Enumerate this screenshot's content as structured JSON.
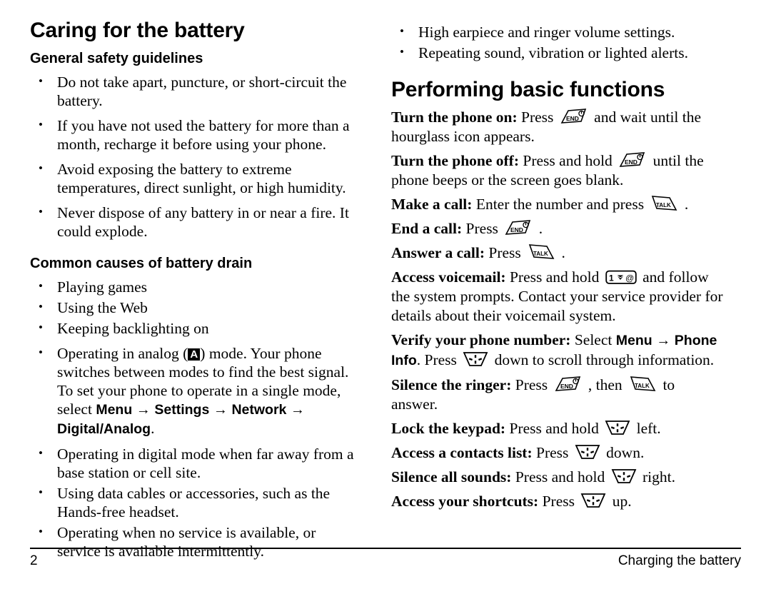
{
  "page": {
    "number": "2",
    "footer_right": "Charging the battery"
  },
  "left_column": {
    "chapter_title": "Caring for the battery",
    "section_1": {
      "heading": "General safety guidelines",
      "bullets": [
        "Do not take apart, puncture, or short-circuit the battery.",
        "If you have not used the battery for more than a month, recharge it before using your phone.",
        "Avoid exposing the battery to extreme temperatures, direct sunlight, or high humidity.",
        "Never dispose of any battery in or near a fire. It could explode."
      ]
    },
    "section_2": {
      "heading": "Common causes of battery drain",
      "bullets": [
        "Playing games",
        "Using the Web",
        "Keeping backlighting on"
      ],
      "analog_bullet": {
        "text_before": "Operating in analog (",
        "badge": "A",
        "text_after": ") mode. Your phone switches between modes to find the best signal. To set your phone to operate in a single mode, select ",
        "menu_path": [
          "Menu",
          "Settings",
          "Network",
          "Digital/Analog"
        ],
        "arrow": "→",
        "period": "."
      },
      "bullets_after": [
        "Operating in digital mode when far away from a base station or cell site.",
        "Using data cables or accessories, such as the Hands-free headset.",
        "Operating when no service is available, or service is available intermittently."
      ]
    }
  },
  "right_column": {
    "top_bullets": [
      "High earpiece and ringer volume settings.",
      "Repeating sound, vibration or lighted alerts."
    ],
    "chapter_title": "Performing basic functions",
    "functions": [
      {
        "label": "Turn the phone on:",
        "parts": [
          {
            "type": "text",
            "value": " Press "
          },
          {
            "type": "icon",
            "value": "end-key-icon"
          },
          {
            "type": "text",
            "value": " and wait until the hourglass icon appears."
          }
        ]
      },
      {
        "label": "Turn the phone off:",
        "parts": [
          {
            "type": "text",
            "value": " Press and hold "
          },
          {
            "type": "icon",
            "value": "end-key-icon"
          },
          {
            "type": "text",
            "value": " until the phone beeps or the screen goes blank."
          }
        ]
      },
      {
        "label": "Make a call:",
        "parts": [
          {
            "type": "text",
            "value": " Enter the number and press "
          },
          {
            "type": "icon",
            "value": "talk-key-icon"
          },
          {
            "type": "text",
            "value": " ."
          }
        ]
      },
      {
        "label": "End a call:",
        "parts": [
          {
            "type": "text",
            "value": " Press "
          },
          {
            "type": "icon",
            "value": "end-key-icon"
          },
          {
            "type": "text",
            "value": " ."
          }
        ]
      },
      {
        "label": "Answer a call:",
        "parts": [
          {
            "type": "text",
            "value": " Press "
          },
          {
            "type": "icon",
            "value": "talk-key-icon"
          },
          {
            "type": "text",
            "value": " ."
          }
        ]
      },
      {
        "label": "Access voicemail:",
        "parts": [
          {
            "type": "text",
            "value": " Press and hold "
          },
          {
            "type": "icon",
            "value": "voicemail-key-icon"
          },
          {
            "type": "text",
            "value": " and follow the system prompts. Contact your service provider for details about their voicemail system."
          }
        ]
      },
      {
        "label": "Verify your phone number:",
        "parts": [
          {
            "type": "text",
            "value": " Select "
          },
          {
            "type": "ui",
            "value": "Menu"
          },
          {
            "type": "arrow",
            "value": " → "
          },
          {
            "type": "ui",
            "value": "Phone Info"
          },
          {
            "type": "text",
            "value": ". Press "
          },
          {
            "type": "icon",
            "value": "nav-key-icon"
          },
          {
            "type": "text",
            "value": " down to scroll through information."
          }
        ]
      },
      {
        "label": "Silence the ringer:",
        "parts": [
          {
            "type": "text",
            "value": " Press "
          },
          {
            "type": "icon",
            "value": "end-key-icon"
          },
          {
            "type": "text",
            "value": " , then "
          },
          {
            "type": "icon",
            "value": "talk-key-icon"
          },
          {
            "type": "text",
            "value": " to answer."
          }
        ]
      },
      {
        "label": "Lock the keypad:",
        "parts": [
          {
            "type": "text",
            "value": " Press and hold "
          },
          {
            "type": "icon",
            "value": "nav-key-icon"
          },
          {
            "type": "text",
            "value": " left."
          }
        ]
      },
      {
        "label": "Access a contacts list:",
        "parts": [
          {
            "type": "text",
            "value": " Press "
          },
          {
            "type": "icon",
            "value": "nav-key-icon"
          },
          {
            "type": "text",
            "value": " down."
          }
        ]
      },
      {
        "label": "Silence all sounds:",
        "parts": [
          {
            "type": "text",
            "value": " Press and hold "
          },
          {
            "type": "icon",
            "value": "nav-key-icon"
          },
          {
            "type": "text",
            "value": " right."
          }
        ]
      },
      {
        "label": "Access your shortcuts:",
        "parts": [
          {
            "type": "text",
            "value": " Press "
          },
          {
            "type": "icon",
            "value": "nav-key-icon"
          },
          {
            "type": "text",
            "value": " up."
          }
        ]
      }
    ]
  },
  "icons": {
    "end-key-icon": {
      "label": "END"
    },
    "talk-key-icon": {
      "label": "TALK"
    },
    "voicemail-key-icon": {
      "label": "1"
    },
    "nav-key-icon": {
      "label": "navigation key"
    }
  }
}
